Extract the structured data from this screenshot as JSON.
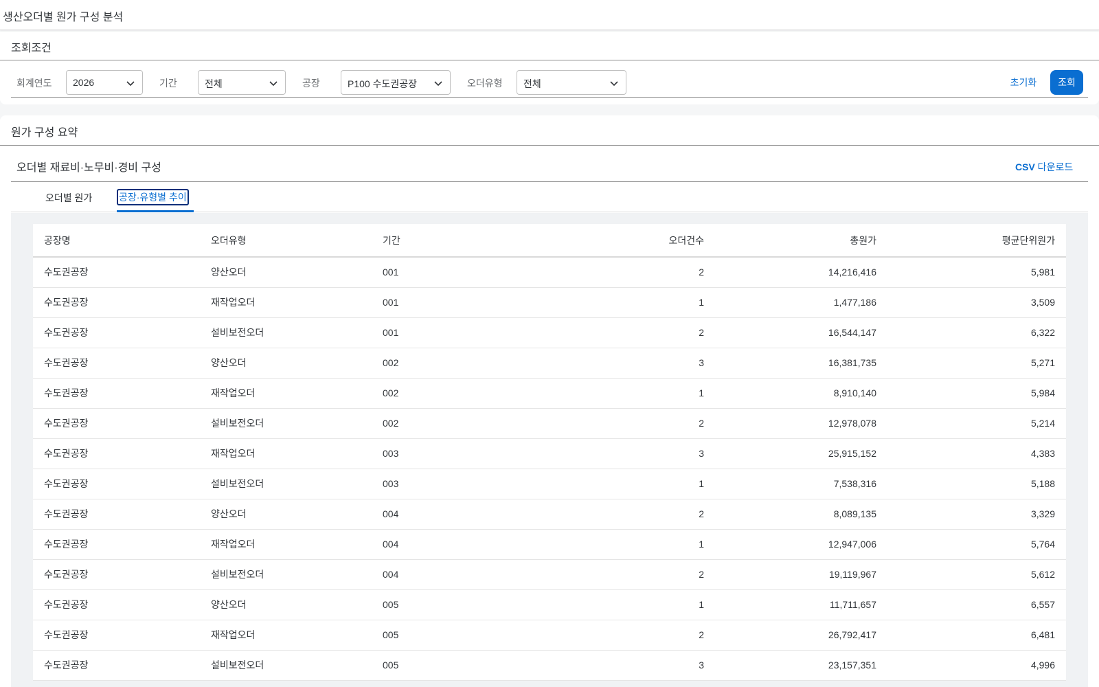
{
  "app": {
    "title": "생산오더별 원가 구성 분석"
  },
  "filter": {
    "header": "조회조건",
    "fiscal_year_label": "회계연도",
    "fiscal_year_value": "2026",
    "period_label": "기간",
    "period_value": "전체",
    "plant_label": "공장",
    "plant_value": "P100 수도권공장",
    "order_type_label": "오더유형",
    "order_type_value": "전체",
    "reset_label": "초기화",
    "search_label": "조회"
  },
  "summary": {
    "header": "원가 구성 요약",
    "card_title": "오더별 재료비·노무비·경비 구성",
    "csv_bold": "CSV",
    "csv_rest": " 다운로드",
    "tabs": [
      {
        "label": "오더별 원가"
      },
      {
        "label": "공장·유형별 추이"
      }
    ]
  },
  "table": {
    "columns": [
      "공장명",
      "오더유형",
      "기간",
      "오더건수",
      "총원가",
      "평균단위원가"
    ],
    "rows": [
      [
        "수도권공장",
        "양산오더",
        "001",
        "2",
        "14,216,416",
        "5,981"
      ],
      [
        "수도권공장",
        "재작업오더",
        "001",
        "1",
        "1,477,186",
        "3,509"
      ],
      [
        "수도권공장",
        "설비보전오더",
        "001",
        "2",
        "16,544,147",
        "6,322"
      ],
      [
        "수도권공장",
        "양산오더",
        "002",
        "3",
        "16,381,735",
        "5,271"
      ],
      [
        "수도권공장",
        "재작업오더",
        "002",
        "1",
        "8,910,140",
        "5,984"
      ],
      [
        "수도권공장",
        "설비보전오더",
        "002",
        "2",
        "12,978,078",
        "5,214"
      ],
      [
        "수도권공장",
        "재작업오더",
        "003",
        "3",
        "25,915,152",
        "4,383"
      ],
      [
        "수도권공장",
        "설비보전오더",
        "003",
        "1",
        "7,538,316",
        "5,188"
      ],
      [
        "수도권공장",
        "양산오더",
        "004",
        "2",
        "8,089,135",
        "3,329"
      ],
      [
        "수도권공장",
        "재작업오더",
        "004",
        "1",
        "12,947,006",
        "5,764"
      ],
      [
        "수도권공장",
        "설비보전오더",
        "004",
        "2",
        "19,119,967",
        "5,612"
      ],
      [
        "수도권공장",
        "양산오더",
        "005",
        "1",
        "11,711,657",
        "6,557"
      ],
      [
        "수도권공장",
        "재작업오더",
        "005",
        "2",
        "26,792,417",
        "6,481"
      ],
      [
        "수도권공장",
        "설비보전오더",
        "005",
        "3",
        "23,157,351",
        "4,996"
      ]
    ]
  }
}
